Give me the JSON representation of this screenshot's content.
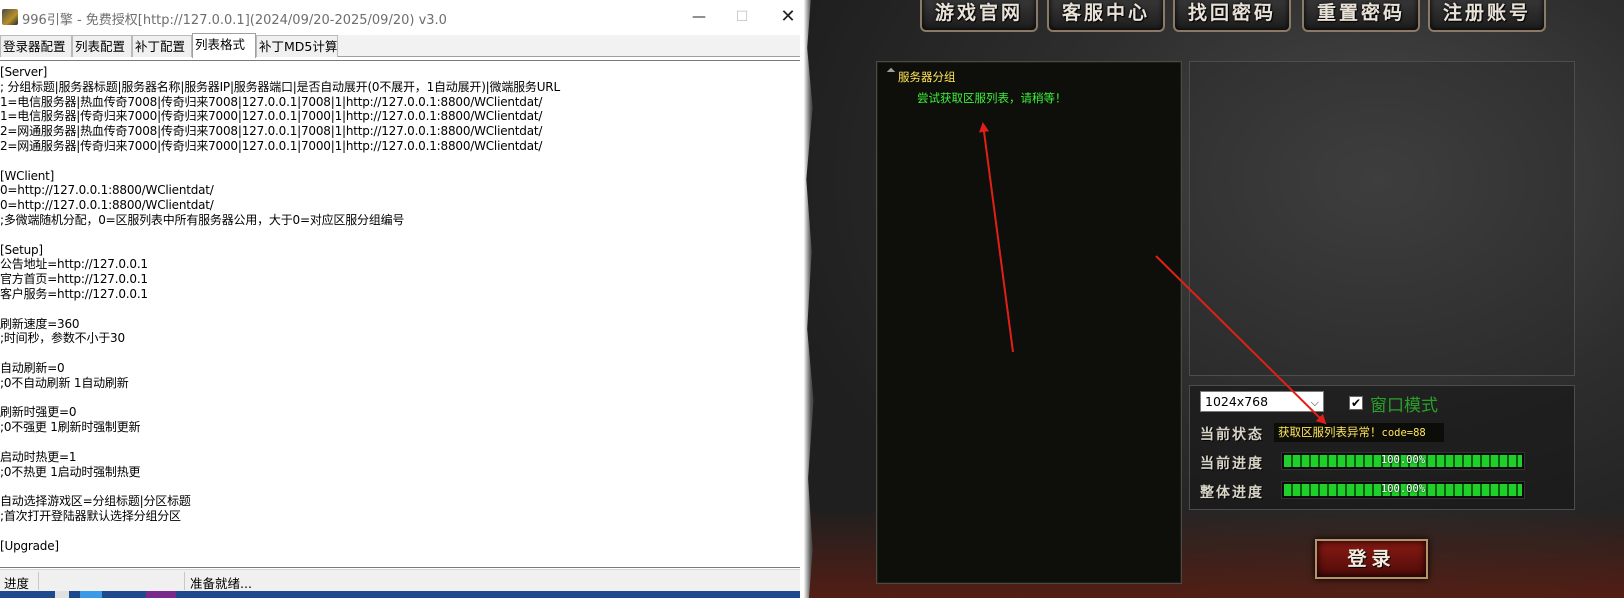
{
  "editor": {
    "title": "996引擎 - 免费授权[http://127.0.0.1](2024/09/20-2025/09/20) v3.0",
    "window_buttons": {
      "minimize": "—",
      "maximize": "☐",
      "close": "✕"
    },
    "tabs": [
      "登录器配置",
      "列表配置",
      "补丁配置",
      "列表格式",
      "补丁MD5计算"
    ],
    "active_tab": "列表格式",
    "lines": [
      "[Server]",
      "; 分组标题|服务器标题|服务器名称|服务器IP|服务器端口|是否自动展开(0不展开，1自动展开)|微端服务URL",
      "1=电信服务器|热血传奇7008|传奇归来7008|127.0.0.1|7008|1|http://127.0.0.1:8800/WClientdat/",
      "1=电信服务器|传奇归来7000|传奇归来7000|127.0.0.1|7000|1|http://127.0.0.1:8800/WClientdat/",
      "2=网通服务器|热血传奇7008|传奇归来7008|127.0.0.1|7008|1|http://127.0.0.1:8800/WClientdat/",
      "2=网通服务器|传奇归来7000|传奇归来7000|127.0.0.1|7000|1|http://127.0.0.1:8800/WClientdat/",
      "",
      "[WClient]",
      "0=http://127.0.0.1:8800/WClientdat/",
      "0=http://127.0.0.1:8800/WClientdat/",
      ";多微端随机分配，0=区服列表中所有服务器公用，大于0=对应区服分组编号",
      "",
      "[Setup]",
      "公告地址=http://127.0.0.1",
      "官方首页=http://127.0.0.1",
      "客户服务=http://127.0.0.1",
      "",
      "刷新速度=360",
      ";时间秒，参数不小于30",
      "",
      "自动刷新=0",
      ";0不自动刷新 1自动刷新",
      "",
      "刷新时强更=0",
      ";0不强更 1刷新时强制更新",
      "",
      "启动时热更=1",
      ";0不热更 1启动时强制热更",
      "",
      "自动选择游戏区=分组标题|分区标题",
      ";首次打开登陆器默认选择分组分区",
      "",
      "[Upgrade]"
    ],
    "status": {
      "progress_label": "进度",
      "message": "准备就绪..."
    }
  },
  "launcher": {
    "nav": [
      "游戏官网",
      "客服中心",
      "找回密码",
      "重置密码",
      "注册账号"
    ],
    "server_group": "服务器分组",
    "loading_msg": "尝试获取区服列表，请稍等！",
    "resolution": "1024x768",
    "window_mode_label": "窗口模式",
    "window_mode_checked": true,
    "status_label": "当前状态",
    "status_text": "获取区服列表异常！",
    "status_code": "code=88",
    "current_progress_label": "当前进度",
    "current_progress_text": "100.00%",
    "current_progress": 1.0,
    "overall_progress_label": "整体进度",
    "overall_progress_text": "100.00%",
    "overall_progress": 1.0,
    "login_label": "登录"
  },
  "colors": {
    "group_label": "#ffe65a",
    "loading_msg": "#3cf03c",
    "window_mode": "#2aa02a",
    "annotation_arrow": "#e02018"
  }
}
